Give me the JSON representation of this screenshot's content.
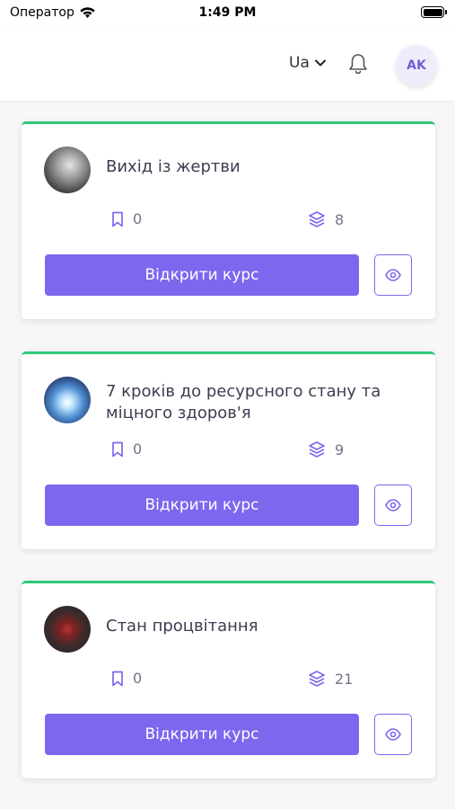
{
  "status_bar": {
    "carrier": "Оператор",
    "time": "1:49 PM"
  },
  "header": {
    "language": "Ua",
    "user_initials": "AK",
    "accent_color": "#7b68ee"
  },
  "courses": [
    {
      "title": "Вихід із жертви",
      "saved_count": "0",
      "lessons_count": "8",
      "open_label": "Відкрити курс",
      "icons": [
        "bookmark-icon",
        "layers-icon",
        "eye-icon"
      ]
    },
    {
      "title": "7 кроків до ресурсного стану та міцного здоров'я",
      "saved_count": "0",
      "lessons_count": "9",
      "open_label": "Відкрити курс",
      "icons": [
        "bookmark-icon",
        "layers-icon",
        "eye-icon"
      ]
    },
    {
      "title": "Стан процвітання",
      "saved_count": "0",
      "lessons_count": "21",
      "open_label": "Відкрити курс",
      "icons": [
        "bookmark-icon",
        "layers-icon",
        "eye-icon"
      ]
    }
  ],
  "colors": {
    "card_top_border": "#2ec97a",
    "button": "#7b68ee"
  }
}
